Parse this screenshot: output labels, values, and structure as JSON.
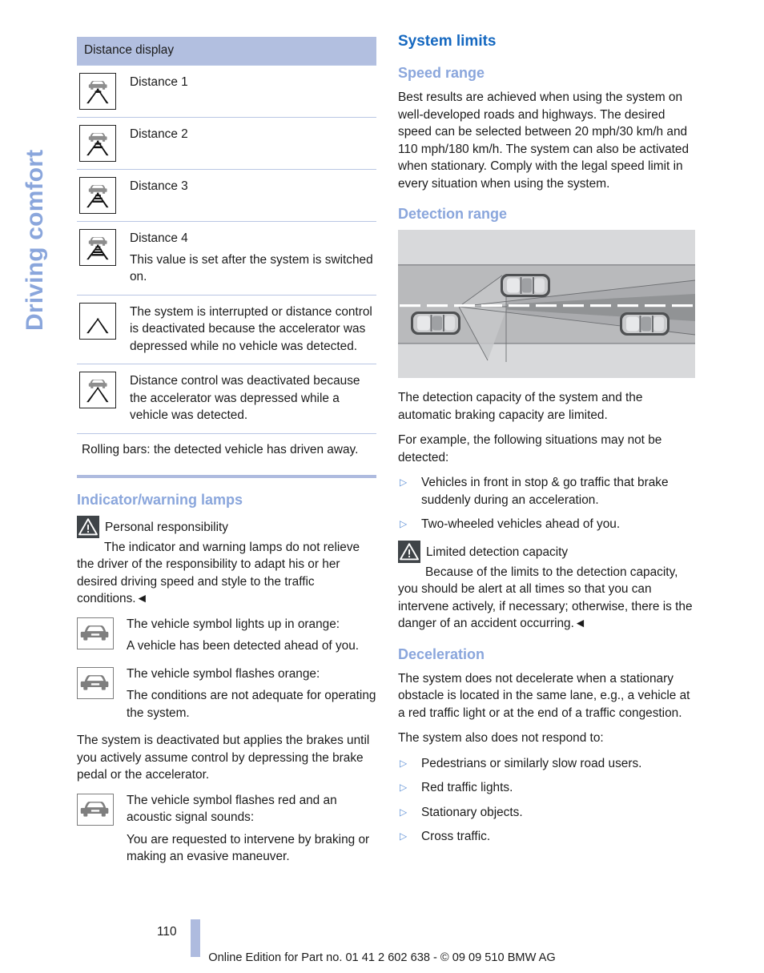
{
  "sidebar": {
    "chapter_label": "Driving comfort"
  },
  "colors": {
    "heading_main": "#1568c0",
    "heading_sub": "#8aa6dc",
    "table_header_bg": "#b2bfe0",
    "rule": "#b9c6e4",
    "bullet": "#5b8ed6",
    "warning_box": "#3f4448",
    "page_marker": "#aebbdf"
  },
  "left_column": {
    "table": {
      "header": "Distance display",
      "rows": [
        {
          "icon": "distance-1-icon",
          "lines": [
            "Distance 1"
          ]
        },
        {
          "icon": "distance-2-icon",
          "lines": [
            "Distance 2"
          ]
        },
        {
          "icon": "distance-3-icon",
          "lines": [
            "Distance 3"
          ]
        },
        {
          "icon": "distance-4-icon",
          "lines": [
            "Distance 4",
            "This value is set after the system is switched on."
          ]
        },
        {
          "icon": "no-vehicle-detected-icon",
          "lines": [
            "The system is interrupted or distance control is deactivated because the accelerator was depressed while no vehicle was detected."
          ]
        },
        {
          "icon": "vehicle-detected-deactivated-icon",
          "lines": [
            "Distance control was deactivated because the accelerator was depressed while a vehicle was detected."
          ]
        }
      ],
      "note": "Rolling bars: the detected vehicle has driven away."
    },
    "indicator_section": {
      "heading": "Indicator/warning lamps",
      "warning": {
        "title": "Personal responsibility",
        "body": "The indicator and warning lamps do not relieve the driver of the responsibility to adapt his or her desired driving speed and style to the traffic conditions.",
        "end_mark": "◄"
      },
      "lamps": [
        {
          "icon": "vehicle-symbol-orange-icon",
          "lines": [
            "The vehicle symbol lights up in orange:",
            "A vehicle has been detected ahead of you."
          ]
        },
        {
          "icon": "vehicle-symbol-flashing-orange-icon",
          "lines": [
            "The vehicle symbol flashes orange:",
            "The conditions are not adequate for operating the system."
          ]
        }
      ],
      "interjection": "The system is deactivated but applies the brakes until you actively assume control by depressing the brake pedal or the accelerator.",
      "lamps_2": [
        {
          "icon": "vehicle-symbol-flashing-red-icon",
          "lines": [
            "The vehicle symbol flashes red and an acoustic signal sounds:",
            "You are requested to intervene by braking or making an evasive maneuver."
          ]
        }
      ]
    }
  },
  "right_column": {
    "heading": "System limits",
    "speed_range": {
      "heading": "Speed range",
      "body": "Best results are achieved when using the system on well-developed roads and highways. The desired speed can be selected between 20 mph/30 km/h and 110 mph/180 km/h. The system can also be activated when stationary. Comply with the legal speed limit in every situation when using the system."
    },
    "detection_range": {
      "heading": "Detection range",
      "figure_name": "detection-range-diagram",
      "body_1": "The detection capacity of the system and the automatic braking capacity are limited.",
      "body_2": "For example, the following situations may not be detected:",
      "bullets": [
        "Vehicles in front in stop & go traffic that brake suddenly during an acceleration.",
        "Two-wheeled vehicles ahead of you."
      ],
      "warning": {
        "title": "Limited detection capacity",
        "body": "Because of the limits to the detection capacity, you should be alert at all times so that you can intervene actively, if necessary; otherwise, there is the danger of an accident occurring.",
        "end_mark": "◄"
      }
    },
    "deceleration": {
      "heading": "Deceleration",
      "body_1": "The system does not decelerate when a stationary obstacle is located in the same lane, e.g., a vehicle at a red traffic light or at the end of a traffic congestion.",
      "body_2": "The system also does not respond to:",
      "bullets": [
        "Pedestrians or similarly slow road users.",
        "Red traffic lights.",
        "Stationary objects.",
        "Cross traffic."
      ]
    }
  },
  "footer": {
    "page_number": "110",
    "imprint": "Online Edition for Part no. 01 41 2 602 638 - © 09 09 510 BMW AG"
  },
  "bullet_glyph": "▷"
}
